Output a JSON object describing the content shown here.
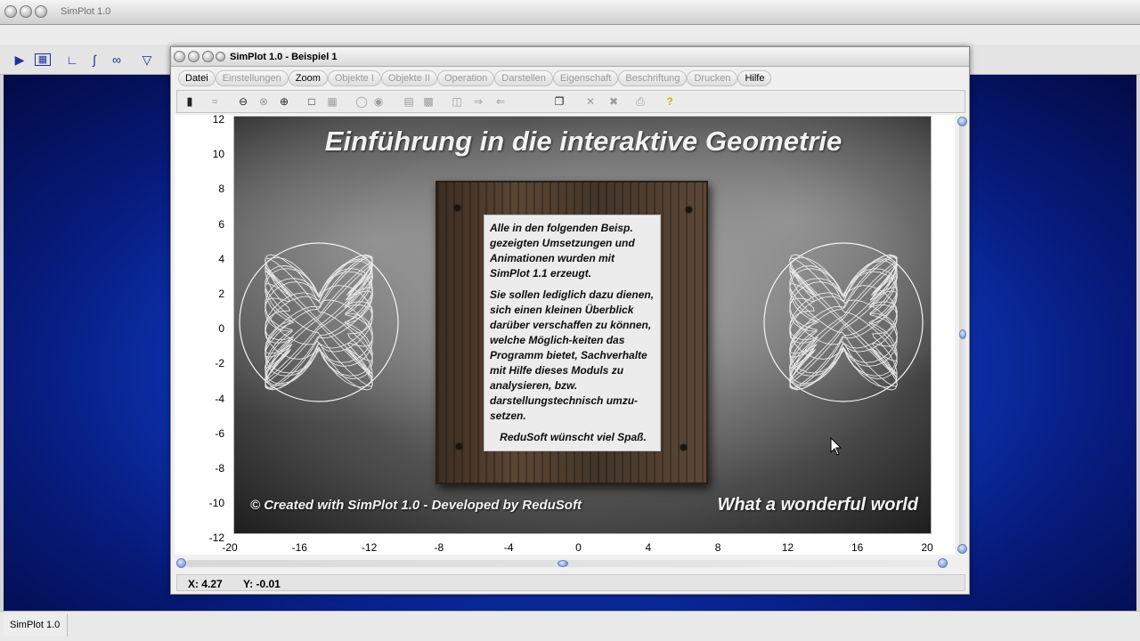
{
  "app": {
    "title": "SimPlot 1.0",
    "status_label": "SimPlot 1.0",
    "toolbar_icons": [
      "play-icon",
      "table-icon",
      "line-chart-icon",
      "function-plot-icon",
      "parametric-icon",
      "filter-icon"
    ]
  },
  "window": {
    "title": "SimPlot 1.0 - Beispiel 1",
    "menu": [
      {
        "label": "Datei",
        "enabled": true
      },
      {
        "label": "Einstellungen",
        "enabled": false
      },
      {
        "label": "Zoom",
        "enabled": true
      },
      {
        "label": "Objekte I",
        "enabled": false
      },
      {
        "label": "Objekte II",
        "enabled": false
      },
      {
        "label": "Operation",
        "enabled": false
      },
      {
        "label": "Darstellen",
        "enabled": false
      },
      {
        "label": "Eigenschaft",
        "enabled": false
      },
      {
        "label": "Beschriftung",
        "enabled": false
      },
      {
        "label": "Drucken",
        "enabled": false
      },
      {
        "label": "Hilfe",
        "enabled": true
      }
    ],
    "toolbar_icons": [
      "calculator-icon",
      "wave-icon",
      "zoom-out-icon",
      "zoom-reset-icon",
      "zoom-in-icon",
      "square-icon",
      "grid-icon",
      "circle-icon",
      "circle-dot-icon",
      "table-icon",
      "edit-table-icon",
      "split-icon",
      "arrow-right-icon",
      "arrow-left-icon",
      "copy-icon",
      "delete-icon",
      "delete-all-icon",
      "print-icon",
      "help-icon"
    ]
  },
  "plot": {
    "y_ticks": [
      "12",
      "10",
      "8",
      "6",
      "4",
      "2",
      "0",
      "-2",
      "-4",
      "-6",
      "-8",
      "-10",
      "-12"
    ],
    "x_ticks": [
      "-20",
      "-16",
      "-12",
      "-8",
      "-4",
      "0",
      "4",
      "8",
      "12",
      "16",
      "20"
    ],
    "title": "Einführung in die interaktive Geometrie",
    "note_paragraph_1": "Alle in den folgenden Beisp. gezeigten Umsetzungen und Animationen wurden mit SimPlot 1.1 erzeugt.",
    "note_paragraph_2": "Sie sollen lediglich dazu dienen, sich einen kleinen Überblick darüber verschaffen zu können, welche Möglich-keiten das Programm bietet, Sachverhalte mit Hilfe dieses Moduls zu analysieren, bzw. darstellungstechnisch umzu-setzen.",
    "note_sign": "ReduSoft wünscht viel Spaß.",
    "footer_left": "© Created with SimPlot 1.0 - Developed by ReduSoft",
    "footer_right": "What a wonderful world"
  },
  "coords": {
    "x": "X: 4.27",
    "y": "Y: -0.01"
  }
}
